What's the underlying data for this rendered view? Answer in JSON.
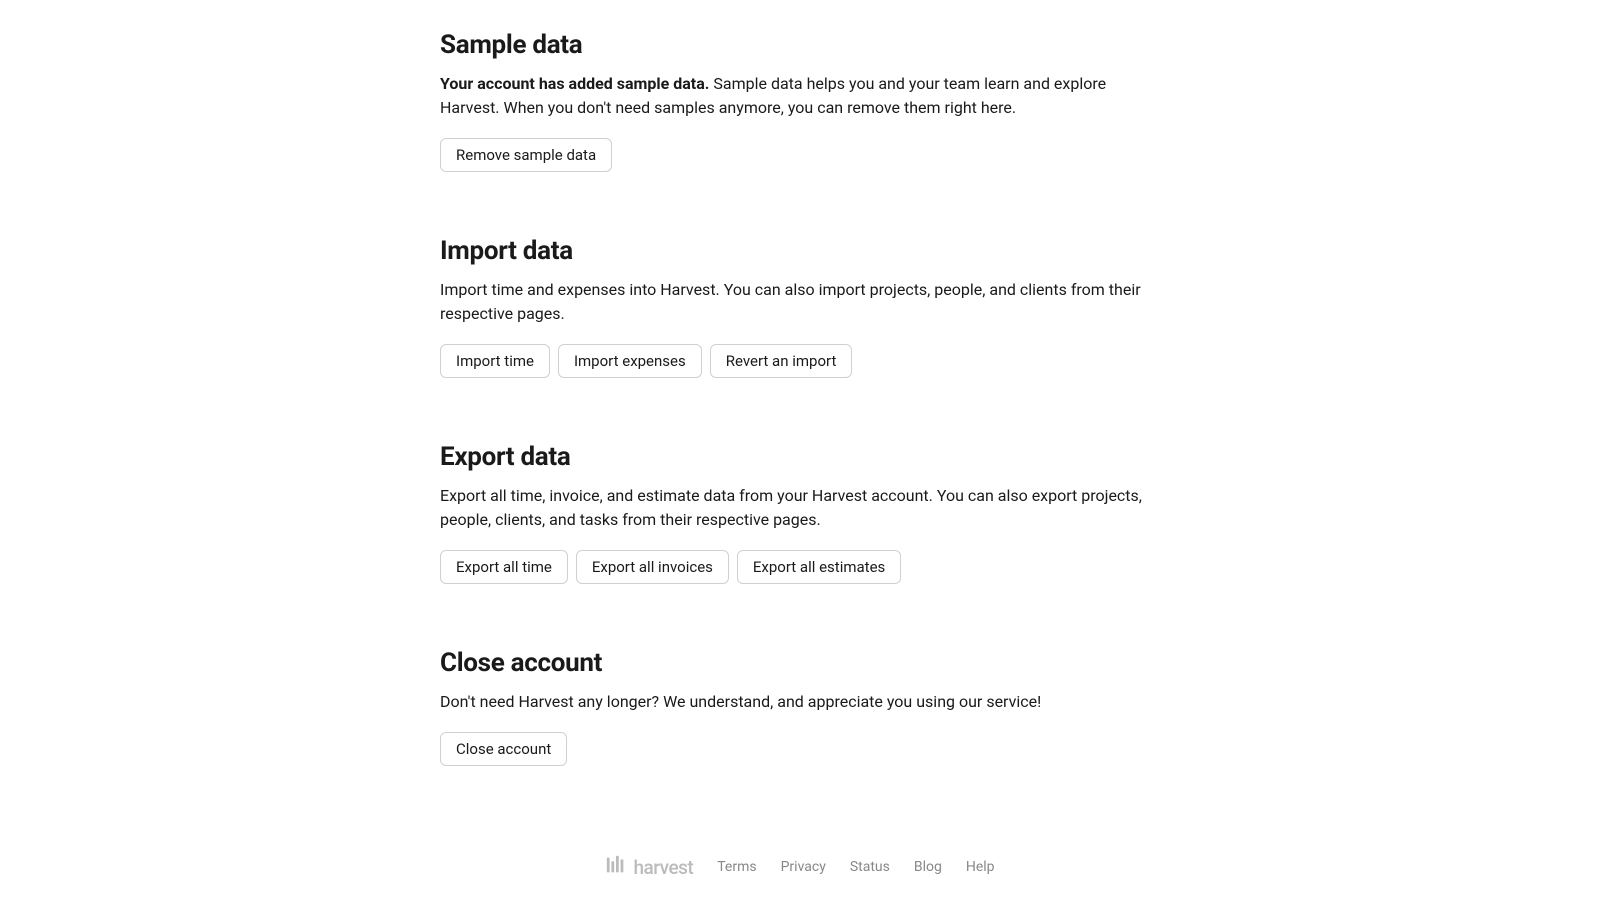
{
  "sections": {
    "sample_data": {
      "heading": "Sample data",
      "description_bold": "Your account has added sample data.",
      "description_rest": " Sample data helps you and your team learn and explore Harvest. When you don't need samples anymore, you can remove them right here.",
      "buttons": {
        "remove": "Remove sample data"
      }
    },
    "import_data": {
      "heading": "Import data",
      "description": "Import time and expenses into Harvest. You can also import projects, people, and clients from their respective pages.",
      "buttons": {
        "import_time": "Import time",
        "import_expenses": "Import expenses",
        "revert_import": "Revert an import"
      }
    },
    "export_data": {
      "heading": "Export data",
      "description": "Export all time, invoice, and estimate data from your Harvest account. You can also export projects, people, clients, and tasks from their respective pages.",
      "buttons": {
        "export_time": "Export all time",
        "export_invoices": "Export all invoices",
        "export_estimates": "Export all estimates"
      }
    },
    "close_account": {
      "heading": "Close account",
      "description": "Don't need Harvest any longer? We understand, and appreciate you using our service!",
      "buttons": {
        "close": "Close account"
      }
    }
  },
  "footer": {
    "brand": "harvest",
    "links": {
      "terms": "Terms",
      "privacy": "Privacy",
      "status": "Status",
      "blog": "Blog",
      "help": "Help"
    }
  }
}
